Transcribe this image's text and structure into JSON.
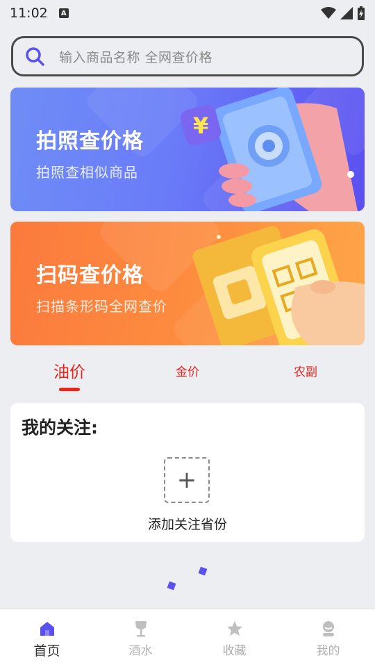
{
  "status_bar": {
    "time": "11:02",
    "notification_letter": "A"
  },
  "search": {
    "placeholder": "输入商品名称 全网查价格"
  },
  "banners": [
    {
      "title": "拍照查价格",
      "subtitle": "拍照查相似商品"
    },
    {
      "title": "扫码查价格",
      "subtitle": "扫描条形码全网查价"
    }
  ],
  "tabs": [
    {
      "label": "油价",
      "active": true
    },
    {
      "label": "金价",
      "active": false
    },
    {
      "label": "农副",
      "active": false
    }
  ],
  "watch": {
    "title": "我的关注:",
    "add_symbol": "+",
    "add_label": "添加关注省份"
  },
  "bottom_nav": [
    {
      "label": "首页",
      "icon": "home-icon",
      "active": true
    },
    {
      "label": "酒水",
      "icon": "wine-glass-icon",
      "active": false
    },
    {
      "label": "收藏",
      "icon": "star-icon",
      "active": false
    },
    {
      "label": "我的",
      "icon": "user-icon",
      "active": false
    }
  ],
  "colors": {
    "accent": "#5b50f0",
    "tab_red": "#e8261d",
    "banner_blue": "#6a7cf8",
    "banner_orange": "#fd8c3f"
  }
}
